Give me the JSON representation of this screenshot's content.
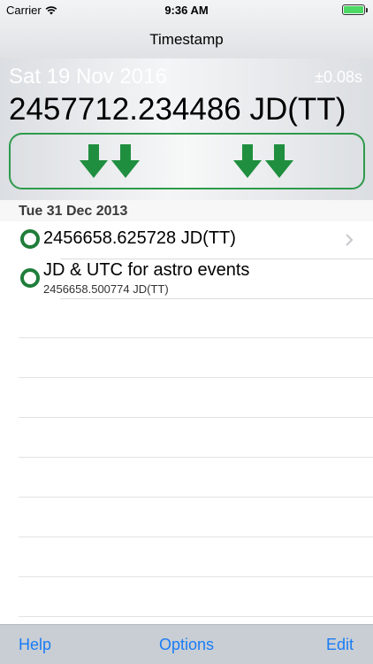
{
  "status": {
    "carrier": "Carrier",
    "time": "9:36 AM"
  },
  "nav": {
    "title": "Timestamp"
  },
  "header": {
    "date": "Sat 19 Nov 2016",
    "precision": "±0.08s",
    "jd": "2457712.234486 JD(TT)"
  },
  "section": {
    "title": "Tue 31 Dec 2013"
  },
  "rows": [
    {
      "title": "2456658.625728 JD(TT)",
      "subtitle": ""
    },
    {
      "title": "JD & UTC for astro events",
      "subtitle": "2456658.500774 JD(TT)"
    }
  ],
  "toolbar": {
    "help": "Help",
    "options": "Options",
    "edit": "Edit"
  },
  "colors": {
    "accent": "#1a7cf5",
    "green": "#1f8f3f",
    "circle": "#1f7d3a",
    "battery": "#4cd964"
  },
  "icons": {
    "stamp": "double-down-arrow-icon",
    "row": "circle-icon",
    "disclosure": "chevron-right-icon"
  }
}
